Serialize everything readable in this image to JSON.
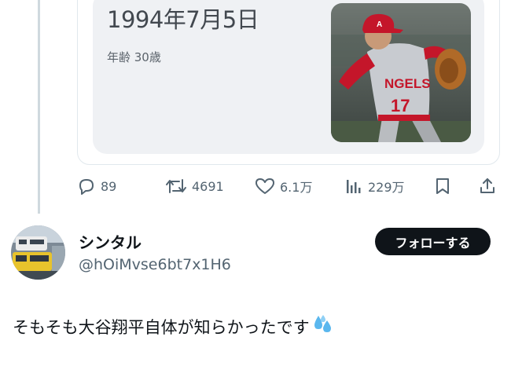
{
  "quoted_card": {
    "birth_date": "1994年7月5日",
    "age": "年齢 30歳",
    "photo_icon": "baseball-pitcher-photo"
  },
  "actions": {
    "replies": "89",
    "reposts": "4691",
    "likes": "6.1万",
    "views": "229万"
  },
  "reply": {
    "display_name": "シンタル",
    "handle": "@hOiMvse6bt7x1H6",
    "follow_label": "フォローする",
    "text": "そもそも大谷翔平自体が知らかったです",
    "emoji_icon": "sweat-droplets-icon"
  },
  "colors": {
    "accent": "#0f1419",
    "muted": "#536471",
    "card_bg": "#eff1f4"
  }
}
